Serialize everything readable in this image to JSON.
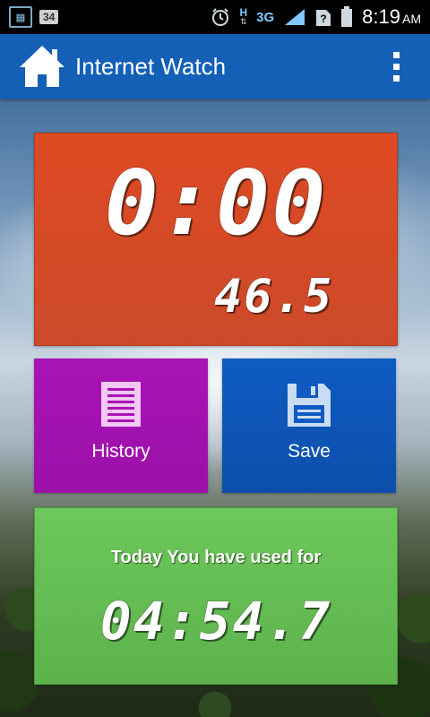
{
  "status_bar": {
    "icons": [
      "sim-card-icon",
      "notification-badge",
      "alarm-icon",
      "network-h-icon",
      "signal-icon",
      "unknown-sim-icon",
      "battery-icon"
    ],
    "badge_number": "34",
    "network_h": "H",
    "network_type": "3G",
    "time": "8:19",
    "ampm": "AM"
  },
  "app_bar": {
    "title": "Internet Watch",
    "home_icon": "home-icon",
    "menu_icon": "overflow-menu-icon"
  },
  "timer": {
    "main": "0:00",
    "sub": "46.5",
    "color": "#d84a24"
  },
  "tiles": {
    "history": {
      "label": "History",
      "icon": "history-list-icon",
      "color": "#a913b6"
    },
    "save": {
      "label": "Save",
      "icon": "floppy-disk-icon",
      "color": "#0f5bc3"
    }
  },
  "usage": {
    "caption": "Today You have used for",
    "value": "04:54.7",
    "color": "#65bd53"
  }
}
